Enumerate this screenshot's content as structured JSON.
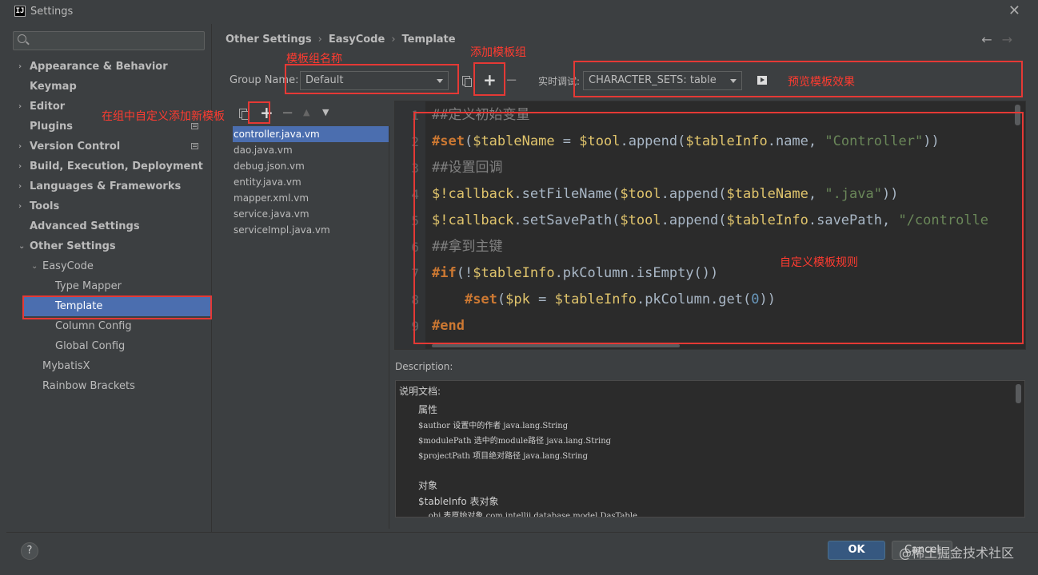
{
  "window": {
    "title": "Settings",
    "app_icon_text": "IJ",
    "close_glyph": "✕"
  },
  "sidebar": {
    "search_placeholder": "",
    "items": [
      {
        "label": "Appearance & Behavior",
        "expander": "›"
      },
      {
        "label": "Keymap"
      },
      {
        "label": "Editor",
        "expander": "›"
      },
      {
        "label": "Plugins"
      },
      {
        "label": "Version Control",
        "expander": "›"
      },
      {
        "label": "Build, Execution, Deployment",
        "expander": "›"
      },
      {
        "label": "Languages & Frameworks",
        "expander": "›"
      },
      {
        "label": "Tools",
        "expander": "›"
      },
      {
        "label": "Advanced Settings"
      },
      {
        "label": "Other Settings",
        "expander": "⌄"
      },
      {
        "label": "EasyCode",
        "expander": "⌄"
      },
      {
        "label": "Type Mapper"
      },
      {
        "label": "Template",
        "selected": true
      },
      {
        "label": "Column Config"
      },
      {
        "label": "Global Config"
      },
      {
        "label": "MybatisX"
      },
      {
        "label": "Rainbow Brackets"
      }
    ]
  },
  "breadcrumb": [
    "Other Settings",
    "EasyCode",
    "Template"
  ],
  "nav": {
    "back": "←",
    "forward": "→"
  },
  "group": {
    "label": "Group Name:",
    "selected": "Default"
  },
  "preview": {
    "label": "实时调试:",
    "selected": "CHARACTER_SETS: table"
  },
  "toolbar_glyphs": {
    "plus": "+",
    "minus": "−",
    "up": "▲",
    "down": "▼"
  },
  "files": [
    "controller.java.vm",
    "dao.java.vm",
    "debug.json.vm",
    "entity.java.vm",
    "mapper.xml.vm",
    "service.java.vm",
    "serviceImpl.java.vm"
  ],
  "code_lines": [
    {
      "n": "1",
      "t": "##定义初始变量"
    },
    {
      "n": "2",
      "t": "#set($tableName = $tool.append($tableInfo.name, \"Controller\"))"
    },
    {
      "n": "3",
      "t": "##设置回调"
    },
    {
      "n": "4",
      "t": "$!callback.setFileName($tool.append($tableName, \".java\"))"
    },
    {
      "n": "5",
      "t": "$!callback.setSavePath($tool.append($tableInfo.savePath, \"/controlle"
    },
    {
      "n": "6",
      "t": "##拿到主键"
    },
    {
      "n": "7",
      "t": "#if(!$tableInfo.pkColumn.isEmpty())"
    },
    {
      "n": "8",
      "t": "    #set($pk = $tableInfo.pkColumn.get(0))"
    },
    {
      "n": "9",
      "t": "#end"
    }
  ],
  "description": {
    "label": "Description:",
    "lines": [
      "说明文档:",
      "属性",
      "$author 设置中的作者 java.lang.String",
      "$modulePath 选中的module路径 java.lang.String",
      "$projectPath 项目绝对路径 java.lang.String",
      "",
      "对象",
      "$tableInfo 表对象",
      "    obj 表原始对象 com.intellij.database.model.DasTable"
    ]
  },
  "footer": {
    "help": "?",
    "ok": "OK",
    "cancel": "Cancel",
    "watermark": "@稀土掘金技术社区"
  },
  "annotations": {
    "group_name": "模板组名称",
    "add_group": "添加模板组",
    "preview": "预览模板效果",
    "add_template": "在组中自定义添加新模板",
    "rules": "自定义模板规则"
  },
  "colors": {
    "accent": "#4b6eaf",
    "annotation_red": "#e53935",
    "ok_button": "#365880"
  }
}
